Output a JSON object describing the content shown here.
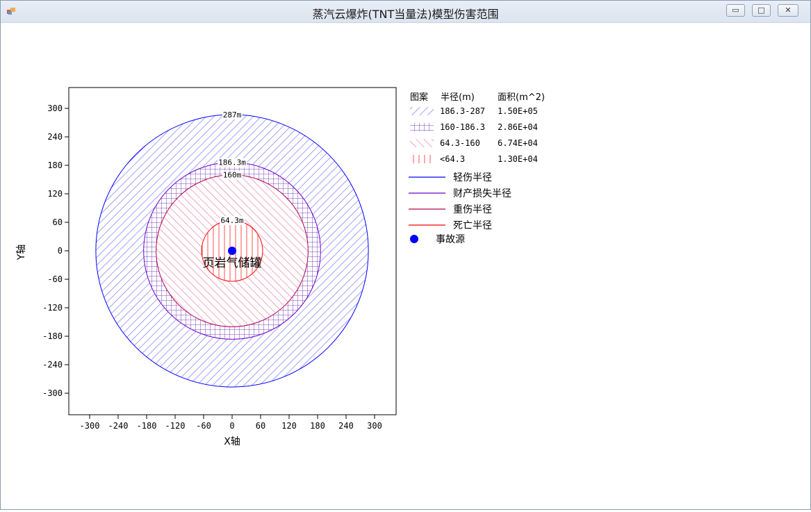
{
  "window": {
    "title": "蒸汽云爆炸(TNT当量法)模型伤害范围",
    "buttons": {
      "minimize": "▭",
      "maximize": "□",
      "close": "✕"
    }
  },
  "chart_data": {
    "type": "area",
    "title": "",
    "xlabel": "X轴",
    "ylabel": "Y轴",
    "xlim": [
      -345,
      345
    ],
    "ylim": [
      -345,
      345
    ],
    "xticks": [
      -300,
      -240,
      -180,
      -120,
      -60,
      0,
      60,
      120,
      180,
      240,
      300
    ],
    "yticks": [
      300,
      240,
      180,
      120,
      60,
      0,
      -60,
      -120,
      -180,
      -240,
      -300
    ],
    "source": {
      "x": 0,
      "y": 0,
      "label": "页岩气储罐"
    },
    "circles": [
      {
        "radius": 287,
        "label": "287m",
        "color": "#0000ff"
      },
      {
        "radius": 186.3,
        "label": "186.3m",
        "color": "#6a00cc"
      },
      {
        "radius": 160,
        "label": "160m",
        "color": "#b0004a"
      },
      {
        "radius": 64.3,
        "label": "64.3m",
        "color": "#ff0000"
      }
    ],
    "legend": {
      "position": "right",
      "headers": [
        "图案",
        "半径(m)",
        "面积(m^2)"
      ],
      "patterns": [
        {
          "range": "186.3-287",
          "area": "1.50E+05",
          "pattern": "diagonal-blue"
        },
        {
          "range": "160-186.3",
          "area": "2.86E+04",
          "pattern": "grid-purple"
        },
        {
          "range": "64.3-160",
          "area": "6.74E+04",
          "pattern": "backslash-pink"
        },
        {
          "range": "<64.3",
          "area": "1.30E+04",
          "pattern": "vertical-red"
        }
      ],
      "lines": [
        {
          "label": "轻伤半径",
          "color": "#0000ff"
        },
        {
          "label": "财产损失半径",
          "color": "#6a00cc"
        },
        {
          "label": "重伤半径",
          "color": "#b0004a"
        },
        {
          "label": "死亡半径",
          "color": "#ff0000"
        }
      ],
      "marker": {
        "label": "事故源",
        "color": "#0000ff"
      }
    }
  }
}
